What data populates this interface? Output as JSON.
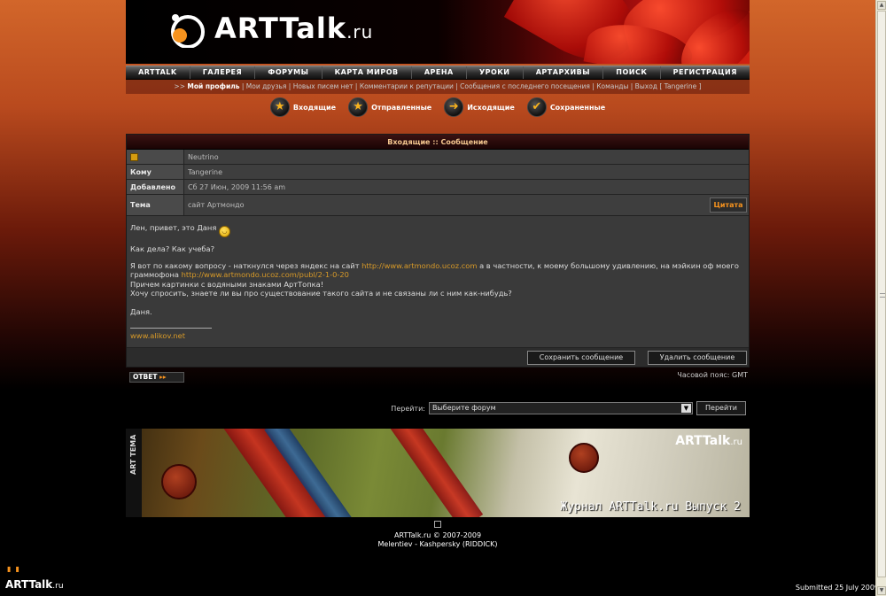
{
  "header": {
    "logo": "ARTTalk",
    "logo_suffix": ".ru"
  },
  "nav": [
    "ARTTALK",
    "ГАЛЕРЕЯ",
    "ФОРУМЫ",
    "КАРТА МИРОВ",
    "АРЕНА",
    "УРОКИ",
    "АРТАРХИВЫ",
    "ПОИСК",
    "РЕГИСТРАЦИЯ"
  ],
  "subnav": {
    "prefix": ">> ",
    "profile": "Мой профиль",
    "rest": " | Мои друзья | Новых писем нет | Комментарии к репутации | Сообщения с последнего посещения | Команды | Выход [ Tangerine ]"
  },
  "folders": [
    {
      "label": "Входящие",
      "icon": "star-icon"
    },
    {
      "label": "Отправленные",
      "icon": "star-icon"
    },
    {
      "label": "Исходящие",
      "icon": "arrow-right-icon"
    },
    {
      "label": "Сохраненные",
      "icon": "checkmark-icon"
    }
  ],
  "message": {
    "title": "Входящие :: Сообщение",
    "from_value": "Neutrino",
    "to_label": "Кому",
    "to_value": "Tangerine",
    "date_label": "Добавлено",
    "date_value": "Сб 27 Июн, 2009 11:56 am",
    "subject_label": "Тема",
    "subject_value": "сайт Артмондо",
    "quote_button": "Цитата",
    "body": {
      "line1": "Лен, привет, это Даня",
      "line2": "Как дела? Как учеба?",
      "line3a": "Я вот по какому вопросу - наткнулся через яндекс на сайт ",
      "link1": "http://www.artmondo.ucoz.com",
      "line3b": " а в частности, к моему большому удивлению, на мэйкин оф моего граммофона ",
      "link2": "http://www.artmondo.ucoz.com/publ/2-1-0-20",
      "line4": "Причем картинки с водяными знаками АртТопка!",
      "line5": "Хочу спросить, знаете ли вы про существование такого сайта и не связаны ли с ним как-нибудь?",
      "line6": "Даня.",
      "signature_link": "www.alikov.net"
    },
    "save_button": "Сохранить сообщение",
    "delete_button": "Удалить сообщение"
  },
  "reply_button": "ОТВЕТ",
  "timezone": "Часовой пояс: GMT",
  "jump": {
    "label": "Перейти:",
    "selected": "Выберите форум",
    "button": "Перейти"
  },
  "banner": {
    "side_text": "ART ТЕМА",
    "logo": "ARTTalk",
    "logo_suffix": ".ru",
    "caption": "Журнал ARTTalk.ru Выпуск 2"
  },
  "footer": {
    "copyright": "ARTTalk.ru © 2007-2009",
    "authors": "Melentiev - Kashpersky (RIDDICK)"
  },
  "bottom": {
    "logo": "ARTTalk",
    "logo_suffix": ".ru",
    "submitted": "Submitted 25 July 2009"
  },
  "colors": {
    "accent": "#f7931e",
    "link": "#d89a28"
  }
}
